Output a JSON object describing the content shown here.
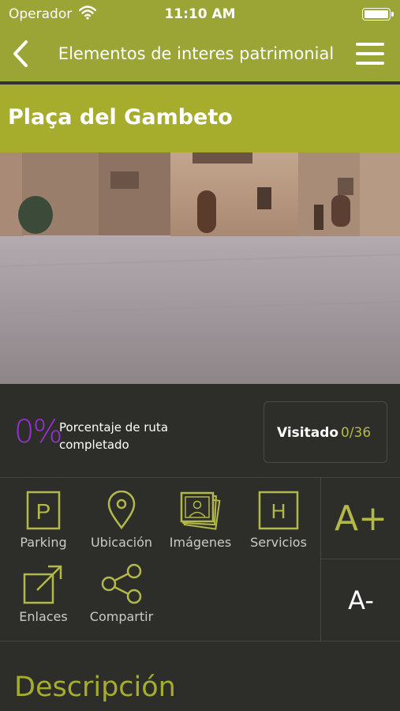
{
  "status": {
    "carrier": "Operador",
    "time": "11:10 AM"
  },
  "nav": {
    "title": "Elementos de interes patrimonial",
    "back_icon": "chevron-left-icon",
    "menu_icon": "hamburger-menu-icon"
  },
  "hero": {
    "title": "Plaça del Gambeto"
  },
  "progress": {
    "percent": "0%",
    "label": "Porcentaje de ruta completado",
    "visited_label": "Visitado",
    "visited_count": "0/36"
  },
  "actions": [
    {
      "label": "Parking",
      "icon": "parking-icon"
    },
    {
      "label": "Ubicación",
      "icon": "location-pin-icon"
    },
    {
      "label": "Imágenes",
      "icon": "photos-icon"
    },
    {
      "label": "Servicios",
      "icon": "hotel-icon"
    },
    {
      "label": "Enlaces",
      "icon": "external-link-icon"
    },
    {
      "label": "Compartir",
      "icon": "share-icon"
    }
  ],
  "font_controls": {
    "increase": "A+",
    "decrease": "A-"
  },
  "section": {
    "title": "Descripción"
  },
  "colors": {
    "accent": "#9aa536",
    "percent": "#9b2fd6",
    "background": "#2d2e2a"
  }
}
